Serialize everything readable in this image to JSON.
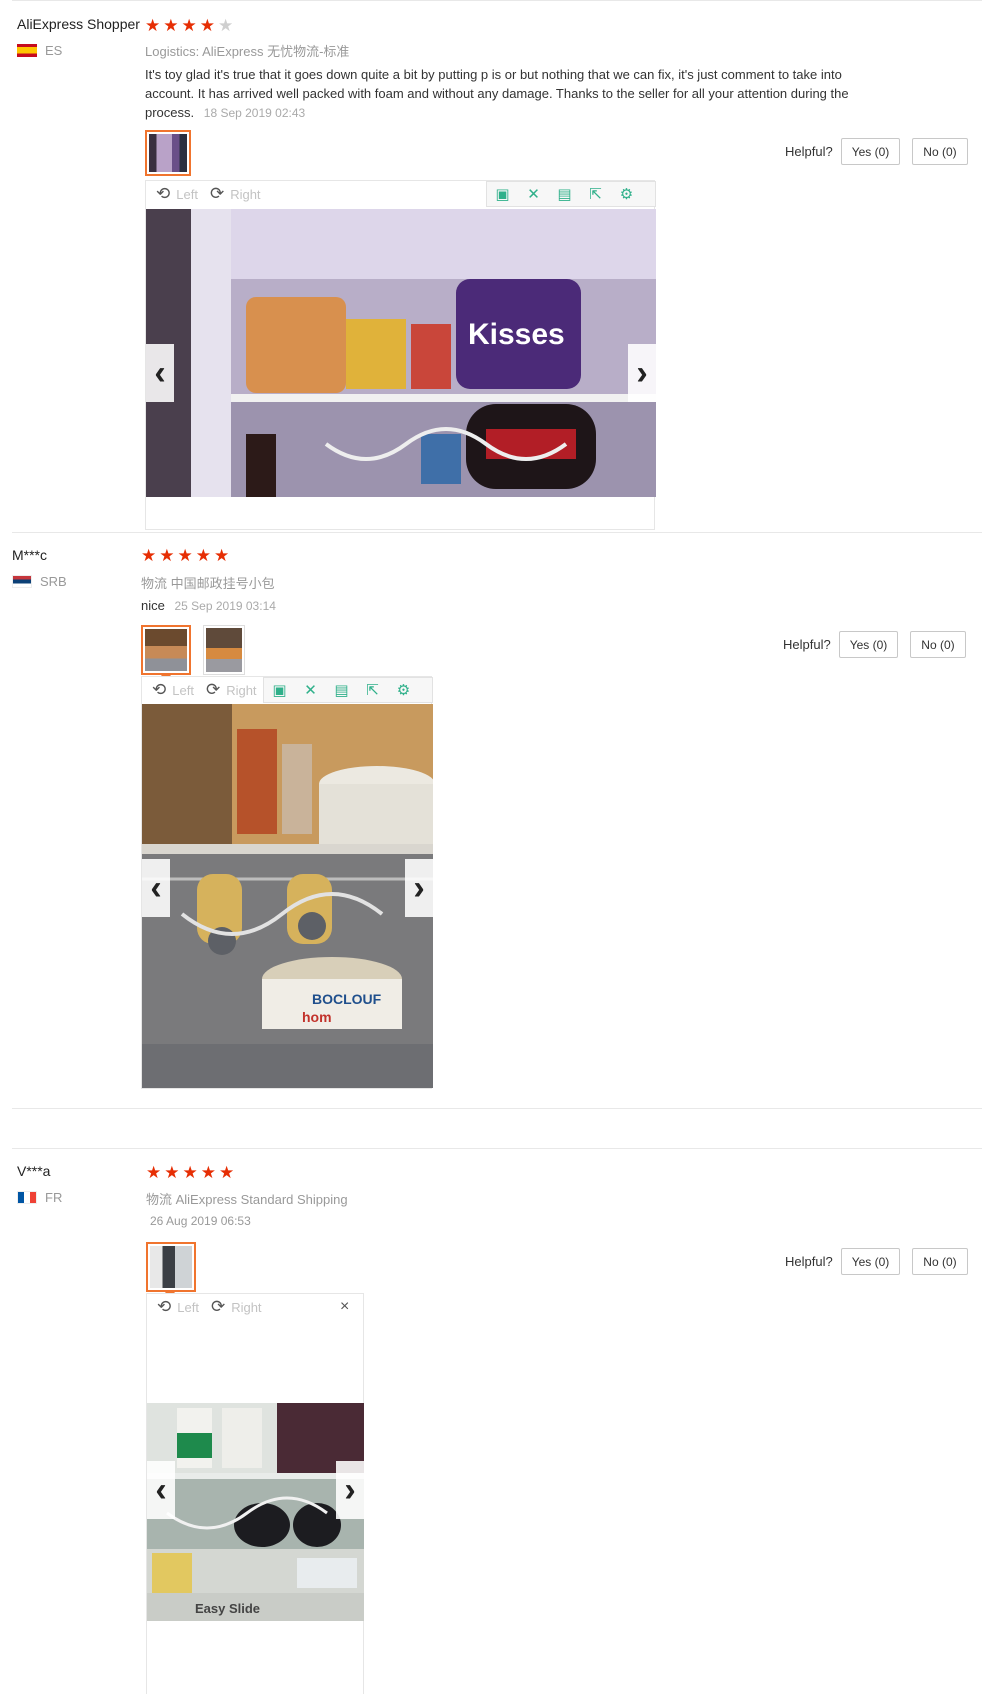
{
  "reviews": [
    {
      "name": "AliExpress Shopper",
      "country": "ES",
      "stars": [
        "★",
        "★",
        "★",
        "★",
        "★"
      ],
      "logistics": "Logistics: AliExpress 无忧物流-标准",
      "text": "It's toy glad it's true that it goes down quite a bit by putting p is or but nothing that we can fix, it's just comment to take into account. It has arrived well packed with foam and without any damage. Thanks to the seller for all your attention during the process.",
      "date": "18 Sep 2019 02:43",
      "helpful": "Helpful?",
      "yes": "Yes (0)",
      "no": "No (0)",
      "rotate_left": "Left",
      "rotate_right": "Right"
    },
    {
      "name": "M***c",
      "country": "SRB",
      "stars": [
        "★",
        "★",
        "★",
        "★",
        "★"
      ],
      "logistics": "物流 中国邮政挂号小包",
      "text": "nice",
      "date": "25 Sep 2019 03:14",
      "helpful": "Helpful?",
      "yes": "Yes (0)",
      "no": "No (0)",
      "rotate_left": "Left",
      "rotate_right": "Right"
    },
    {
      "name": "V***a",
      "country": "FR",
      "stars": [
        "★",
        "★",
        "★",
        "★",
        "★"
      ],
      "logistics": "物流 AliExpress Standard Shipping",
      "date": "26 Aug 2019 06:53",
      "helpful": "Helpful?",
      "yes": "Yes (0)",
      "no": "No (0)",
      "rotate_left": "Left",
      "rotate_right": "Right",
      "photo_caption": "Easy Slide"
    }
  ],
  "icons": {
    "prev": "‹",
    "next": "›",
    "rotate_left": "⟲",
    "rotate_right": "⟳",
    "close": "×",
    "tools": [
      "fit-icon",
      "fullscreen-icon",
      "save-icon",
      "share-icon",
      "settings-icon"
    ]
  },
  "ratings": [
    4,
    5,
    5
  ],
  "colors": {
    "star": "#e62e04",
    "accent": "#f0742e",
    "tool": "#2fb08a"
  }
}
